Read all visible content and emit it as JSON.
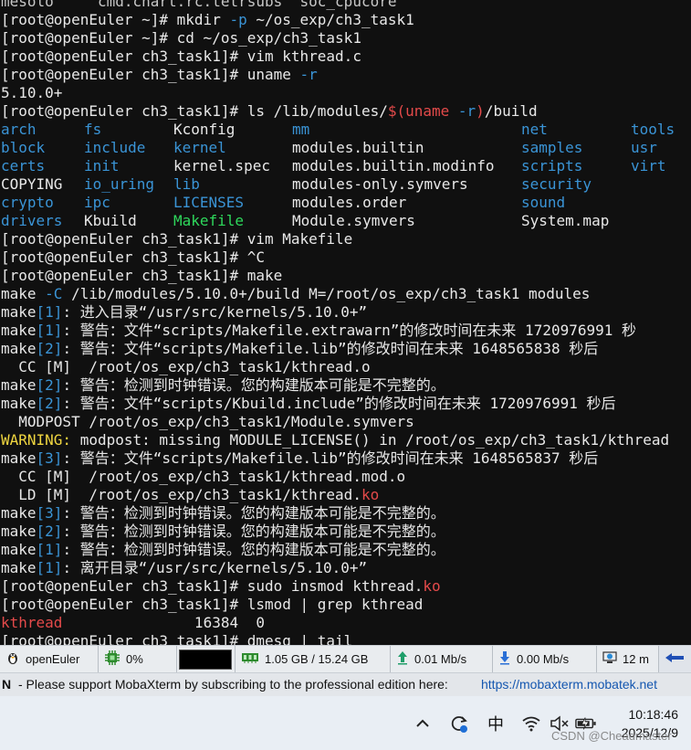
{
  "terminal": {
    "lines": [
      {
        "segs": [
          {
            "t": "mesolo     cmd.chart.rc.tetrsubs  soc_cpucore",
            "c": "dim"
          }
        ]
      },
      {
        "segs": [
          {
            "t": "[root@openEuler ~]# mkdir ",
            "c": "white"
          },
          {
            "t": "-p",
            "c": "blue"
          },
          {
            "t": " ~/os_exp/ch3_task1",
            "c": "white"
          }
        ]
      },
      {
        "segs": [
          {
            "t": "[root@openEuler ~]# cd ~/os_exp/ch3_task1",
            "c": "white"
          }
        ]
      },
      {
        "segs": [
          {
            "t": "[root@openEuler ch3_task1]# vim kthread.c",
            "c": "white"
          }
        ]
      },
      {
        "segs": [
          {
            "t": "[root@openEuler ch3_task1]# uname ",
            "c": "white"
          },
          {
            "t": "-r",
            "c": "blue"
          }
        ]
      },
      {
        "segs": [
          {
            "t": "5.10.0+",
            "c": "white"
          }
        ]
      },
      {
        "segs": [
          {
            "t": "[root@openEuler ch3_task1]# ls /lib/modules/",
            "c": "white"
          },
          {
            "t": "$(",
            "c": "red"
          },
          {
            "t": "uname ",
            "c": "red"
          },
          {
            "t": "-r",
            "c": "blue"
          },
          {
            "t": ")",
            "c": "red"
          },
          {
            "t": "/build",
            "c": "white"
          }
        ]
      }
    ],
    "ls_rows": [
      [
        {
          "t": "arch",
          "c": "blue"
        },
        {
          "t": "fs",
          "c": "blue"
        },
        {
          "t": "Kconfig",
          "c": "white"
        },
        {
          "t": "mm",
          "c": "blue"
        },
        {
          "t": "net",
          "c": "blue"
        },
        {
          "t": "tools",
          "c": "blue"
        }
      ],
      [
        {
          "t": "block",
          "c": "blue"
        },
        {
          "t": "include",
          "c": "blue"
        },
        {
          "t": "kernel",
          "c": "blue"
        },
        {
          "t": "modules.builtin",
          "c": "white"
        },
        {
          "t": "samples",
          "c": "blue"
        },
        {
          "t": "usr",
          "c": "blue"
        }
      ],
      [
        {
          "t": "certs",
          "c": "blue"
        },
        {
          "t": "init",
          "c": "blue"
        },
        {
          "t": "kernel.spec",
          "c": "white"
        },
        {
          "t": "modules.builtin.modinfo",
          "c": "white"
        },
        {
          "t": "scripts",
          "c": "blue"
        },
        {
          "t": "virt",
          "c": "blue"
        }
      ],
      [
        {
          "t": "COPYING",
          "c": "white"
        },
        {
          "t": "io_uring",
          "c": "blue"
        },
        {
          "t": "lib",
          "c": "blue"
        },
        {
          "t": "modules-only.symvers",
          "c": "white"
        },
        {
          "t": "security",
          "c": "blue"
        },
        {
          "t": "",
          "c": "white"
        }
      ],
      [
        {
          "t": "crypto",
          "c": "blue"
        },
        {
          "t": "ipc",
          "c": "blue"
        },
        {
          "t": "LICENSES",
          "c": "blue"
        },
        {
          "t": "modules.order",
          "c": "white"
        },
        {
          "t": "sound",
          "c": "blue"
        },
        {
          "t": "",
          "c": "white"
        }
      ],
      [
        {
          "t": "drivers",
          "c": "blue"
        },
        {
          "t": "Kbuild",
          "c": "white"
        },
        {
          "t": "Makefile",
          "c": "green"
        },
        {
          "t": "Module.symvers",
          "c": "white"
        },
        {
          "t": "System.map",
          "c": "white"
        },
        {
          "t": "",
          "c": "white"
        }
      ]
    ],
    "lines2": [
      {
        "segs": [
          {
            "t": "[root@openEuler ch3_task1]# vim Makefile",
            "c": "white"
          }
        ]
      },
      {
        "segs": [
          {
            "t": "[root@openEuler ch3_task1]# ^C",
            "c": "white"
          }
        ]
      },
      {
        "segs": [
          {
            "t": "[root@openEuler ch3_task1]# make",
            "c": "white"
          }
        ]
      },
      {
        "segs": [
          {
            "t": "make ",
            "c": "white"
          },
          {
            "t": "-C",
            "c": "blue"
          },
          {
            "t": " /lib/modules/5.10.0+/build M=/root/os_exp/ch3_task1 modules",
            "c": "white"
          }
        ]
      },
      {
        "segs": [
          {
            "t": "make",
            "c": "white"
          },
          {
            "t": "[1]",
            "c": "blue"
          },
          {
            "t": ": 进入目录“/usr/src/kernels/5.10.0+”",
            "c": "white"
          }
        ]
      },
      {
        "segs": [
          {
            "t": "make",
            "c": "white"
          },
          {
            "t": "[1]",
            "c": "blue"
          },
          {
            "t": ": 警告：文件“scripts/Makefile.extrawarn”的修改时间在未来 1720976991 秒",
            "c": "white"
          }
        ]
      },
      {
        "segs": [
          {
            "t": "make",
            "c": "white"
          },
          {
            "t": "[2]",
            "c": "blue"
          },
          {
            "t": ": 警告：文件“scripts/Makefile.lib”的修改时间在未来 1648565838 秒后",
            "c": "white"
          }
        ]
      },
      {
        "segs": [
          {
            "t": "  CC [M]  /root/os_exp/ch3_task1/kthread.o",
            "c": "white"
          }
        ]
      },
      {
        "segs": [
          {
            "t": "make",
            "c": "white"
          },
          {
            "t": "[2]",
            "c": "blue"
          },
          {
            "t": ": 警告：检测到时钟错误。您的构建版本可能是不完整的。",
            "c": "white"
          }
        ]
      },
      {
        "segs": [
          {
            "t": "make",
            "c": "white"
          },
          {
            "t": "[2]",
            "c": "blue"
          },
          {
            "t": ": 警告：文件“scripts/Kbuild.include”的修改时间在未来 1720976991 秒后",
            "c": "white"
          }
        ]
      },
      {
        "segs": [
          {
            "t": "  MODPOST /root/os_exp/ch3_task1/Module.symvers",
            "c": "white"
          }
        ]
      },
      {
        "segs": [
          {
            "t": "WARNING:",
            "c": "yellow"
          },
          {
            "t": " modpost: missing MODULE_LICENSE() in /root/os_exp/ch3_task1/kthread",
            "c": "white"
          }
        ]
      },
      {
        "segs": [
          {
            "t": "make",
            "c": "white"
          },
          {
            "t": "[3]",
            "c": "blue"
          },
          {
            "t": ": 警告：文件“scripts/Makefile.lib”的修改时间在未来 1648565837 秒后",
            "c": "white"
          }
        ]
      },
      {
        "segs": [
          {
            "t": "  CC [M]  /root/os_exp/ch3_task1/kthread.mod.o",
            "c": "white"
          }
        ]
      },
      {
        "segs": [
          {
            "t": "  LD [M]  /root/os_exp/ch3_task1/kthread.",
            "c": "white"
          },
          {
            "t": "ko",
            "c": "red"
          }
        ]
      },
      {
        "segs": [
          {
            "t": "make",
            "c": "white"
          },
          {
            "t": "[3]",
            "c": "blue"
          },
          {
            "t": ": 警告：检测到时钟错误。您的构建版本可能是不完整的。",
            "c": "white"
          }
        ]
      },
      {
        "segs": [
          {
            "t": "make",
            "c": "white"
          },
          {
            "t": "[2]",
            "c": "blue"
          },
          {
            "t": ": 警告：检测到时钟错误。您的构建版本可能是不完整的。",
            "c": "white"
          }
        ]
      },
      {
        "segs": [
          {
            "t": "make",
            "c": "white"
          },
          {
            "t": "[1]",
            "c": "blue"
          },
          {
            "t": ": 警告：检测到时钟错误。您的构建版本可能是不完整的。",
            "c": "white"
          }
        ]
      },
      {
        "segs": [
          {
            "t": "make",
            "c": "white"
          },
          {
            "t": "[1]",
            "c": "blue"
          },
          {
            "t": ": 离开目录“/usr/src/kernels/5.10.0+”",
            "c": "white"
          }
        ]
      },
      {
        "segs": [
          {
            "t": "[root@openEuler ch3_task1]# sudo insmod kthread.",
            "c": "white"
          },
          {
            "t": "ko",
            "c": "red"
          }
        ]
      },
      {
        "segs": [
          {
            "t": "[root@openEuler ch3_task1]# lsmod | grep kthread",
            "c": "white"
          }
        ]
      },
      {
        "segs": [
          {
            "t": "kthread",
            "c": "red"
          },
          {
            "t": "               16384  0",
            "c": "white"
          }
        ]
      },
      {
        "segs": [
          {
            "t": "[root@openEuler ch3_task1]# dmesg | tail",
            "c": "white"
          }
        ]
      }
    ]
  },
  "statusbar": {
    "host": "openEuler",
    "cpu": "0%",
    "memory": "1.05 GB / 15.24 GB",
    "upload": "0.01 Mb/s",
    "download": "0.00 Mb/s",
    "time_trunc": "12 m"
  },
  "notice": {
    "letter": "N",
    "text": " -  Please support MobaXterm by subscribing to the professional edition here:",
    "link": "https://mobaxterm.mobatek.net"
  },
  "taskbar": {
    "ime": "中",
    "time": "10:18:46",
    "date": "2025/12/9",
    "watermark": "CSDN @Cheadmaster"
  },
  "colors": {
    "white": "#e8e8e8",
    "blue": "#3a94d6",
    "red": "#e44a4a",
    "green": "#2ed85c",
    "yellow": "#f0d640",
    "dim": "#c8c8c8"
  }
}
